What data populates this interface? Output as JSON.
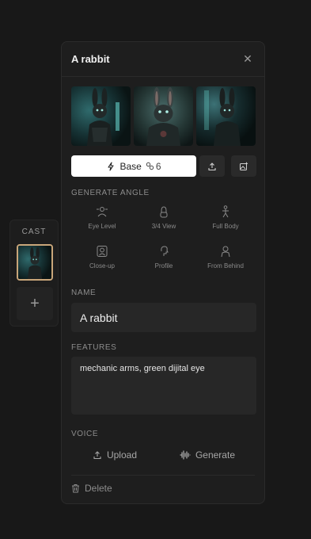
{
  "cast": {
    "title": "CAST",
    "add_icon": "plus-icon"
  },
  "panel": {
    "title": "A rabbit",
    "close_icon": "close-icon"
  },
  "base_button": {
    "label": "Base",
    "count": "6",
    "icon": "lightning-icon",
    "count_icon": "link-icon"
  },
  "actions": {
    "upload_icon": "upload-icon",
    "add_image_icon": "image-plus-icon"
  },
  "generate_angle": {
    "label": "GENERATE ANGLE",
    "options": [
      {
        "label": "Eye Level",
        "icon": "eye-level-icon"
      },
      {
        "label": "3/4 View",
        "icon": "three-quarter-view-icon"
      },
      {
        "label": "Full Body",
        "icon": "full-body-icon"
      },
      {
        "label": "Close-up",
        "icon": "close-up-icon"
      },
      {
        "label": "Profile",
        "icon": "profile-icon"
      },
      {
        "label": "From Behind",
        "icon": "from-behind-icon"
      }
    ]
  },
  "name": {
    "label": "NAME",
    "value": "A rabbit"
  },
  "features": {
    "label": "FEATURES",
    "value": "mechanic arms, green dijital eye"
  },
  "voice": {
    "label": "VOICE",
    "upload_label": "Upload",
    "generate_label": "Generate"
  },
  "delete": {
    "label": "Delete"
  },
  "colors": {
    "background": "#181818",
    "panel": "#1e1e1e",
    "field": "#272727",
    "accent_border": "#c9a67a",
    "primary_button": "#ffffff"
  }
}
